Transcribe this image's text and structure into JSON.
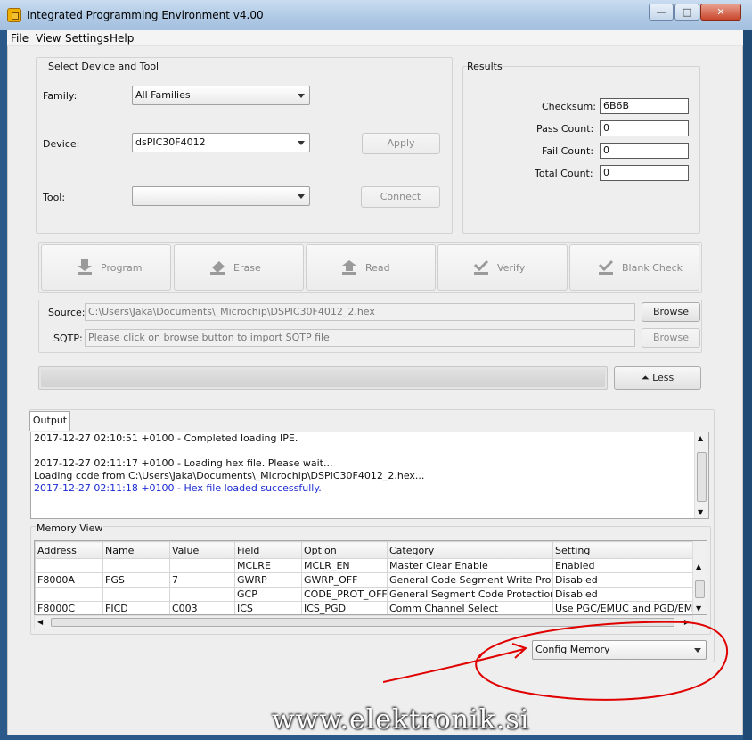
{
  "window": {
    "title": "Integrated Programming Environment v4.00",
    "controls": {
      "minimize": "—",
      "maximize": "□",
      "close": "✕"
    }
  },
  "menu": [
    "File",
    "View",
    "Settings",
    "Help"
  ],
  "device_group": {
    "title": "Select Device and Tool",
    "family_label": "Family:",
    "family_value": "All Families",
    "device_label": "Device:",
    "device_value": "dsPIC30F4012",
    "tool_label": "Tool:",
    "tool_value": "",
    "apply_label": "Apply",
    "connect_label": "Connect"
  },
  "results": {
    "title": "Results",
    "checksum_label": "Checksum:",
    "checksum_value": "6B6B",
    "pass_label": "Pass Count:",
    "pass_value": "0",
    "fail_label": "Fail Count:",
    "fail_value": "0",
    "total_label": "Total Count:",
    "total_value": "0"
  },
  "operations": [
    {
      "label": "Program",
      "icon": "program-icon"
    },
    {
      "label": "Erase",
      "icon": "erase-icon"
    },
    {
      "label": "Read",
      "icon": "read-icon"
    },
    {
      "label": "Verify",
      "icon": "verify-icon"
    },
    {
      "label": "Blank Check",
      "icon": "blank-check-icon"
    }
  ],
  "source": {
    "label": "Source:",
    "value": "C:\\Users\\Jaka\\Documents\\_Microchip\\DSPIC30F4012_2.hex",
    "browse_label": "Browse"
  },
  "sqtp": {
    "label": "SQTP:",
    "value": "Please click on browse button to import SQTP file",
    "browse_label": "Browse"
  },
  "less_label": "Less",
  "output": {
    "tab_label": "Output",
    "lines": [
      {
        "text": "2017-12-27 02:10:51 +0100 - Completed loading IPE.",
        "color": "#000000"
      },
      {
        "text": "",
        "color": "#000000"
      },
      {
        "text": "2017-12-27 02:11:17 +0100 - Loading hex file. Please wait...",
        "color": "#000000"
      },
      {
        "text": "Loading code from C:\\Users\\Jaka\\Documents\\_Microchip\\DSPIC30F4012_2.hex...",
        "color": "#000000"
      },
      {
        "text": "2017-12-27 02:11:18 +0100 - Hex file loaded successfully.",
        "color": "#1c2bd1"
      }
    ]
  },
  "memory_view": {
    "title": "Memory View",
    "columns": [
      "Address",
      "Name",
      "Value",
      "Field",
      "Option",
      "Category",
      "Setting"
    ],
    "rows": [
      [
        "",
        "",
        "",
        "MCLRE",
        "MCLR_EN",
        "Master Clear Enable",
        "Enabled"
      ],
      [
        "F8000A",
        "FGS",
        "7",
        "GWRP",
        "GWRP_OFF",
        "General Code Segment Write Protect",
        "Disabled"
      ],
      [
        "",
        "",
        "",
        "GCP",
        "CODE_PROT_OFF",
        "General Segment Code Protection",
        "Disabled"
      ],
      [
        "F8000C",
        "FICD",
        "C003",
        "ICS",
        "ICS_PGD",
        "Comm Channel Select",
        "Use PGC/EMUC and PGD/EMUD"
      ]
    ],
    "view_select": "Config Memory"
  },
  "watermark": "www.elektronik.si",
  "colors": {
    "annotation": "#e00000",
    "log_success": "#1c2bd1"
  }
}
